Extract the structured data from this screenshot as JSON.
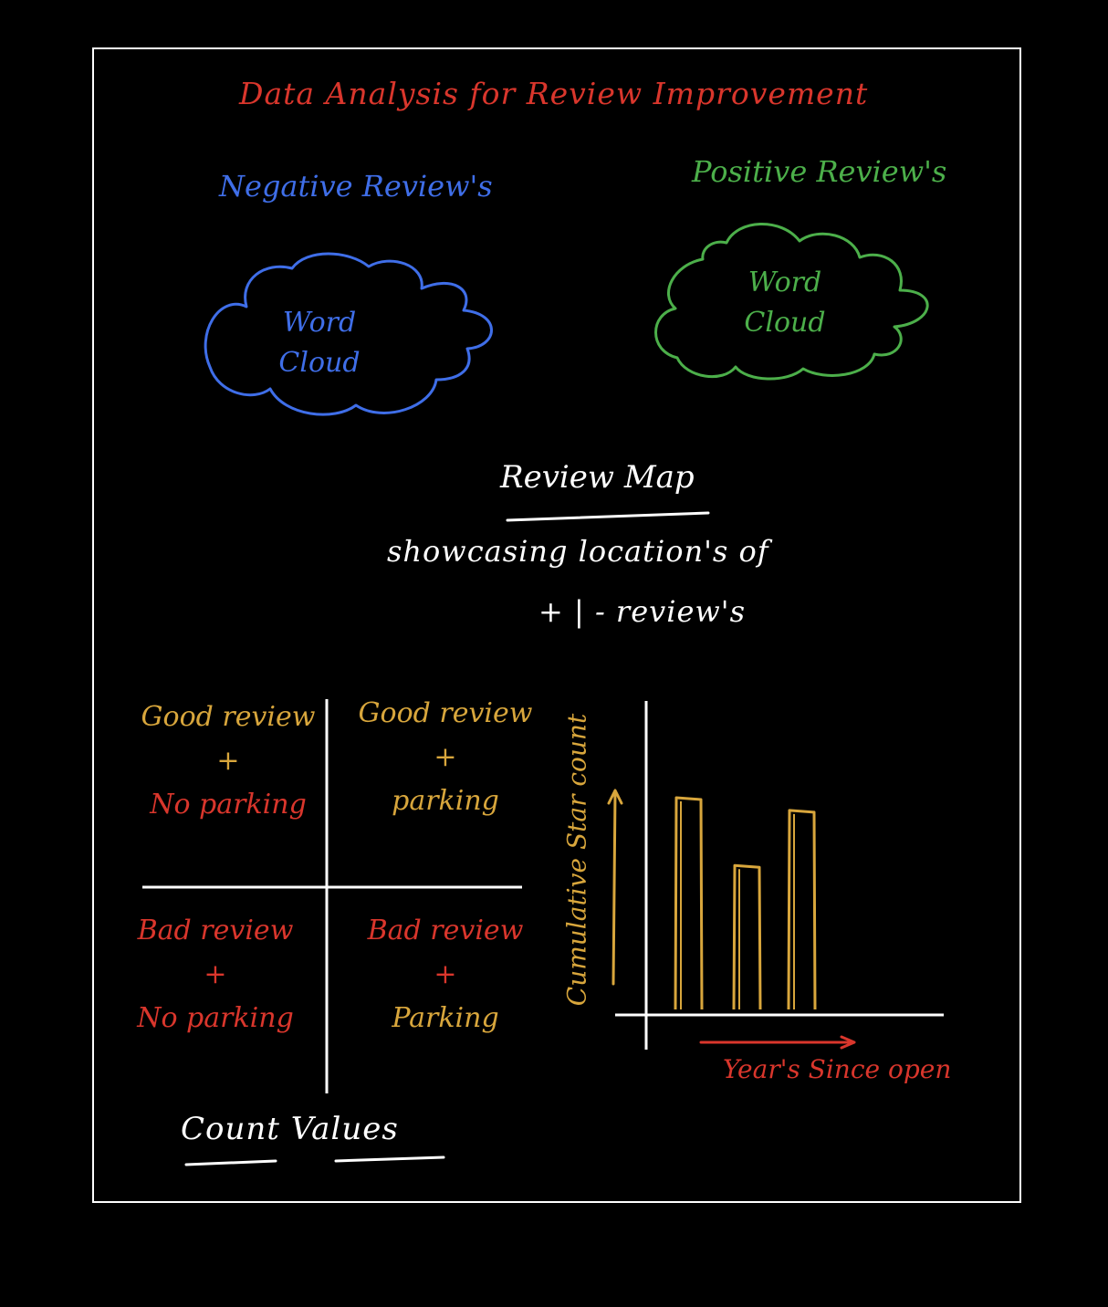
{
  "title": "Data Analysis for Review Improvement",
  "negative_reviews": {
    "heading": "Negative Review's",
    "cloud_line1": "Word",
    "cloud_line2": "Cloud",
    "color": "#3f6ee8"
  },
  "positive_reviews": {
    "heading": "Positive Review's",
    "cloud_line1": "Word",
    "cloud_line2": "Cloud",
    "color": "#4caf4a"
  },
  "review_map": {
    "title": "Review Map",
    "line1": "showcasing location's of",
    "line2": "+ | - review's"
  },
  "quadrants": {
    "top_left": {
      "line1": "Good review",
      "line2": "+",
      "line3": "No parking"
    },
    "top_right": {
      "line1": "Good review",
      "line2": "+",
      "line3": "parking"
    },
    "bottom_left": {
      "line1": "Bad review",
      "line2": "+",
      "line3": "No parking"
    },
    "bottom_right": {
      "line1": "Bad review",
      "line2": "+",
      "line3": "Parking"
    }
  },
  "count_values": "Count Values",
  "colors": {
    "red": "#d9362c",
    "gold": "#d8a63c",
    "white": "#ffffff",
    "background": "#000000"
  },
  "chart_data": {
    "type": "bar",
    "ylabel": "Cumulative Star count",
    "xlabel": "Year's Since open",
    "categories": [],
    "values": [
      100,
      68,
      94
    ],
    "ylim": [
      0,
      100
    ],
    "grid": false
  }
}
